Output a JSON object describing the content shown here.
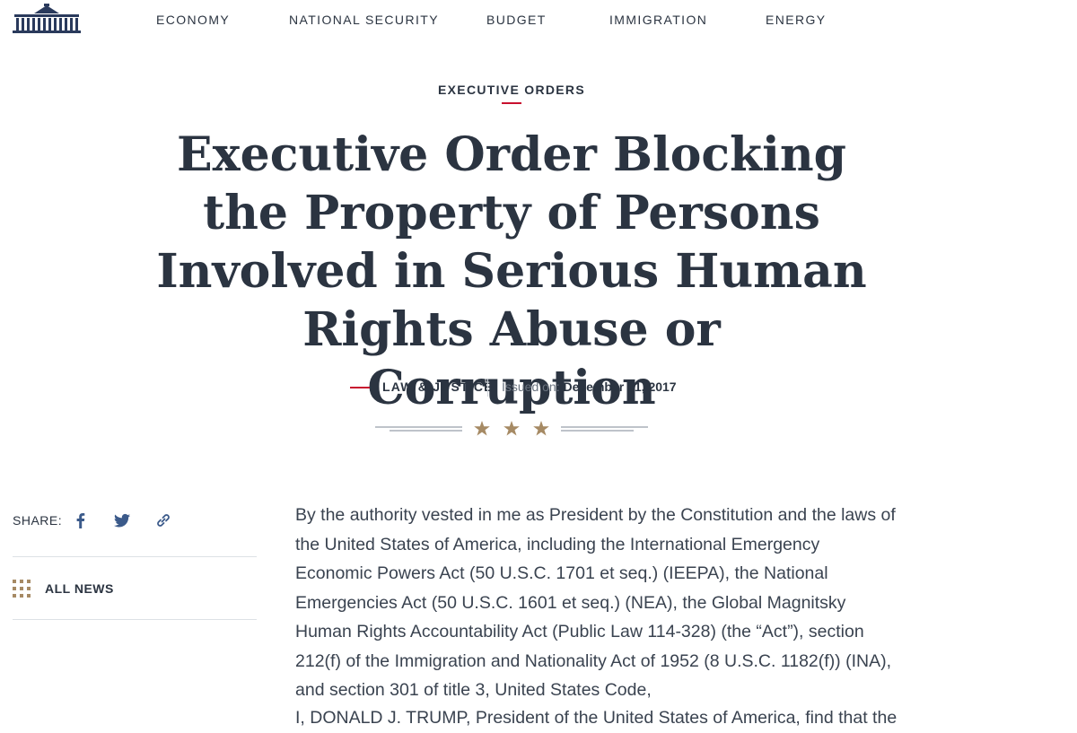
{
  "nav": {
    "items": [
      "ECONOMY",
      "NATIONAL SECURITY",
      "BUDGET",
      "IMMIGRATION",
      "ENERGY"
    ]
  },
  "article": {
    "kicker": "EXECUTIVE ORDERS",
    "title": "Executive Order Blocking the Property of Persons Involved in Serious Human Rights Abuse or Corruption",
    "category": "LAW & JUSTICE",
    "issued_label": "Issued on:",
    "issued_date": "December 21, 2017",
    "paragraphs": [
      "By the authority vested in me as President by the Constitution and the laws of the United States of America, including the International Emergency Economic Powers Act (50 U.S.C. 1701 et seq.) (IEEPA), the National Emergencies Act (50 U.S.C. 1601 et seq.) (NEA), the Global Magnitsky Human Rights Accountability Act (Public Law 114-328) (the “Act”), section 212(f) of the Immigration and Nationality Act of 1952 (8 U.S.C. 1182(f)) (INA), and section 301 of title 3, United States Code,",
      "I, DONALD J. TRUMP, President of the United States of America, find that the"
    ]
  },
  "share": {
    "label": "SHARE:",
    "buttons": [
      "facebook-icon",
      "twitter-icon",
      "link-icon"
    ]
  },
  "all_news": {
    "label": "ALL NEWS",
    "icon": "grid-icon"
  },
  "colors": {
    "text": "#2b3441",
    "accent_red": "#c8102e",
    "gold": "#a68a64",
    "navy": "#2a3a5c"
  }
}
